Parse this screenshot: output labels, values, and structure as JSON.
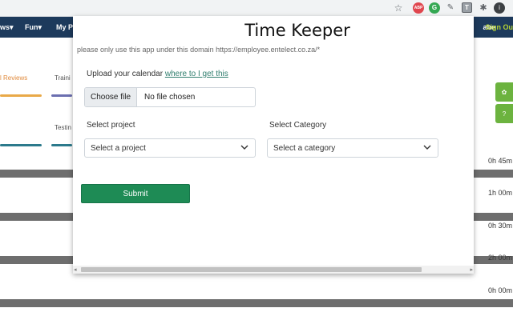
{
  "browser": {
    "star_icon": "☆",
    "abp_icon": "ABP",
    "grammarly_icon": "G",
    "edit_icon": "✎",
    "timekeeper_icon": "T",
    "extensions_icon": "✱",
    "avatar_icon": "i"
  },
  "site": {
    "nav": {
      "item1": "ws▾",
      "item2": "Fun▾",
      "item3": "My P",
      "user": "abe",
      "signout": "Sign Ou"
    },
    "cards": {
      "reviews": "l Reviews",
      "trainings": "Traini",
      "testing": "Testin"
    },
    "side_buttons": {
      "b1": "✿",
      "b2": "?"
    },
    "times": [
      "0h 45m",
      "1h 00m",
      "0h 30m",
      "2h 00m",
      "0h 00m"
    ]
  },
  "popup": {
    "title": "Time Keeper",
    "notice": "please only use this app under this domain https://employee.entelect.co.za/*",
    "upload_label": "Upload your calendar",
    "upload_link": "where to I get this",
    "file_button": "Choose file",
    "file_status": "No file chosen",
    "project_label": "Select project",
    "project_placeholder": "Select a project",
    "category_label": "Select Category",
    "category_placeholder": "Select a category",
    "submit_label": "Submit",
    "scroll_left": "◂",
    "scroll_right": "▸"
  },
  "colors": {
    "nav_bg": "#1d3a5c",
    "submit_bg": "#1e8b55",
    "side_button": "#6cb33f",
    "link": "#2f7d6d"
  }
}
